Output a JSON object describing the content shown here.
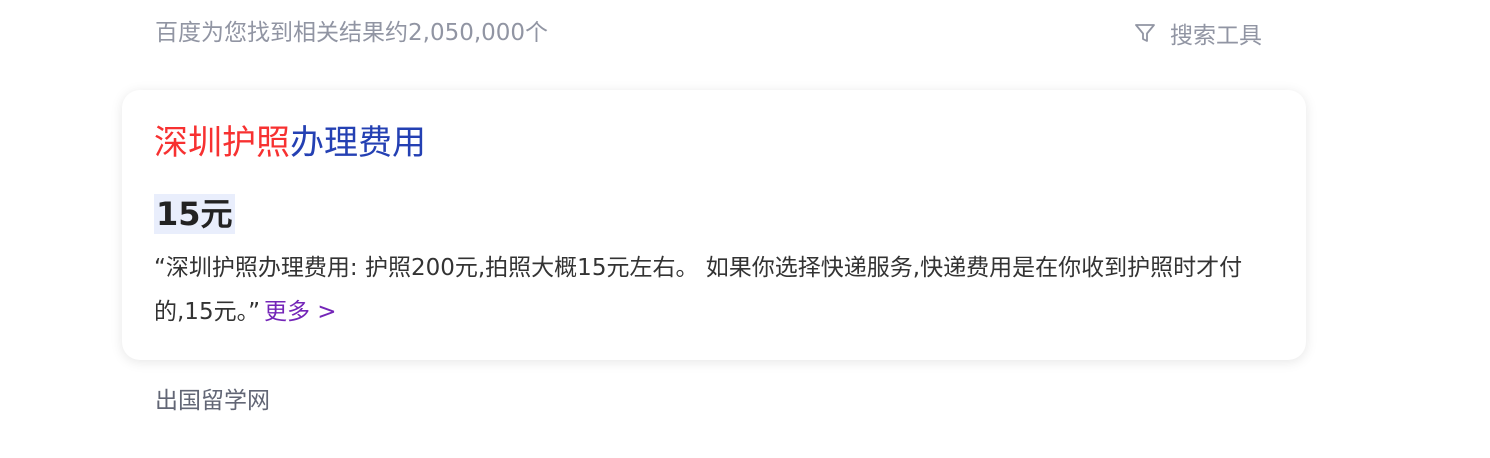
{
  "header": {
    "result_count": "百度为您找到相关结果约2,050,000个",
    "search_tools_label": "搜索工具",
    "search_tools_icon": "filter-icon"
  },
  "card": {
    "title_highlight": "深圳护照",
    "title_rest": "办理费用",
    "answer": "15元",
    "snippet": "“深圳护照办理费用: 护照200元,拍照大概15元左右。 如果你选择快递服务,快递费用是在你收到护照时才付的,15元。”",
    "more_label": "更多 >"
  },
  "source": {
    "name": "出国留学网"
  },
  "colors": {
    "highlight": "#f73131",
    "title_link": "#2440b3",
    "more_link": "#7425b8",
    "muted": "#9195a3",
    "answer_bg": "#e9eefc"
  }
}
